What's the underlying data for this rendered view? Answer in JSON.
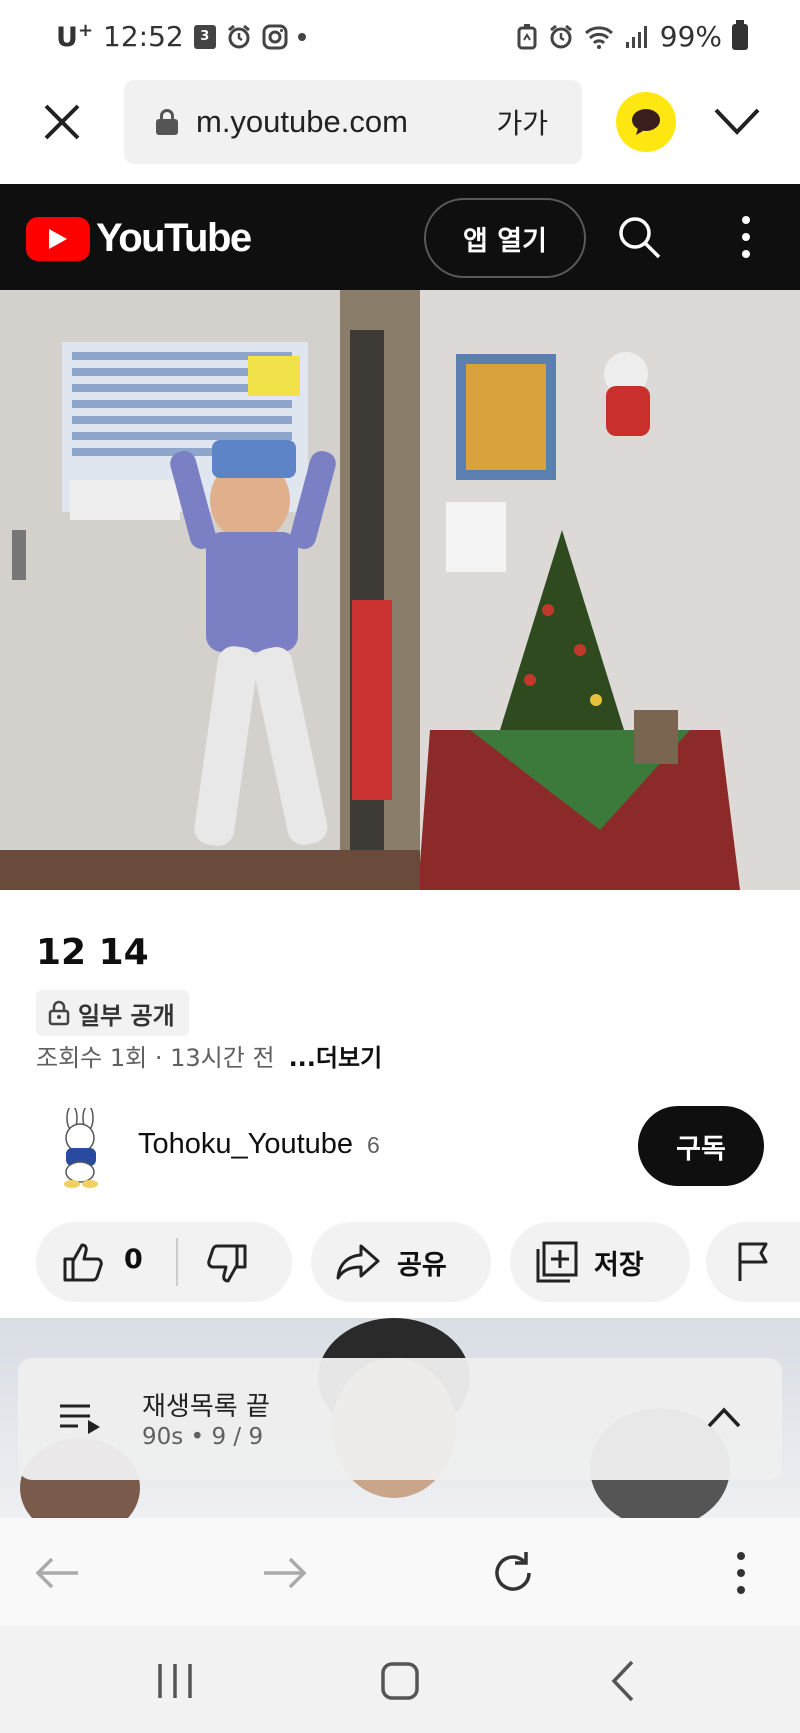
{
  "status_bar": {
    "carrier": "U",
    "carrier_sup": "+",
    "time": "12:52",
    "box_badge": "3",
    "battery": "99%"
  },
  "browser": {
    "url": "m.youtube.com",
    "text_size_label": "가가"
  },
  "youtube_header": {
    "logo_text": "YouTube",
    "open_app_label": "앱 열기"
  },
  "video": {
    "title": "12 14",
    "visibility_badge": "일부 공개",
    "views": "조회수 1회",
    "separator": "·",
    "age": "13시간 전",
    "more_label": "...더보기"
  },
  "channel": {
    "name": "Tohoku_Youtube",
    "subscribers": "6",
    "subscribe_label": "구독"
  },
  "actions": {
    "like_count": "0",
    "share_label": "공유",
    "save_label": "저장"
  },
  "playlist": {
    "title": "재생목록 끝",
    "subtitle": "90s • 9 / 9"
  },
  "colors": {
    "youtube_red": "#ff0000",
    "header_bg": "#0f0f0f",
    "kakao_yellow": "#ffe812"
  }
}
